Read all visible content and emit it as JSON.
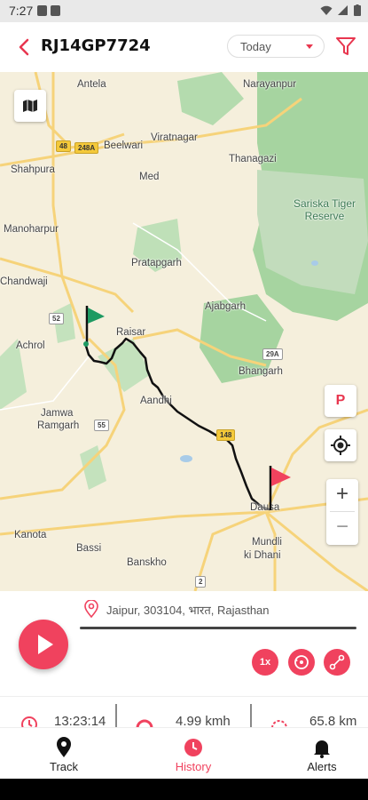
{
  "status_bar": {
    "time": "7:27"
  },
  "header": {
    "vehicle_number": "RJ14GP7724",
    "date_filter": "Today"
  },
  "map": {
    "labels": [
      {
        "text": "Antela"
      },
      {
        "text": "Narayanpur"
      },
      {
        "text": "Beelwari"
      },
      {
        "text": "Viratnagar"
      },
      {
        "text": "Thanagazi"
      },
      {
        "text": "Shahpura"
      },
      {
        "text": "Med"
      },
      {
        "text": "Manoharpur"
      },
      {
        "text": "Pratapgarh"
      },
      {
        "text": "Chandwaji"
      },
      {
        "text": "Ajabgarh"
      },
      {
        "text": "Raisar"
      },
      {
        "text": "Achrol"
      },
      {
        "text": "Bhangarh"
      },
      {
        "text": "Aandhi"
      },
      {
        "text": "Jamwa"
      },
      {
        "text": "Ramgarh"
      },
      {
        "text": "Dausa"
      },
      {
        "text": "Kanota"
      },
      {
        "text": "Bassi"
      },
      {
        "text": "Banskho"
      },
      {
        "text": "Mundli"
      },
      {
        "text": "ki Dhani"
      }
    ],
    "green_labels": [
      "Sariska Tiger",
      "Reserve"
    ],
    "shields": [
      "48",
      "248A",
      "52",
      "29A",
      "55",
      "148",
      "2"
    ],
    "parking_label": "P",
    "zoom_in": "+",
    "zoom_out": "−"
  },
  "player": {
    "address": "Jaipur, 303104, भारत, Rajasthan",
    "progress": 0.0,
    "speed_button": "1x"
  },
  "stats": {
    "time": "13:23:14",
    "speed": "4.99 kmh",
    "distance": "65.8 km"
  },
  "bottom_nav": {
    "track": "Track",
    "history": "History",
    "alerts": "Alerts"
  },
  "colors": {
    "accent": "#f0425e",
    "route": "#111111",
    "start_flag": "#1e9a62",
    "end_flag": "#f0425e"
  }
}
